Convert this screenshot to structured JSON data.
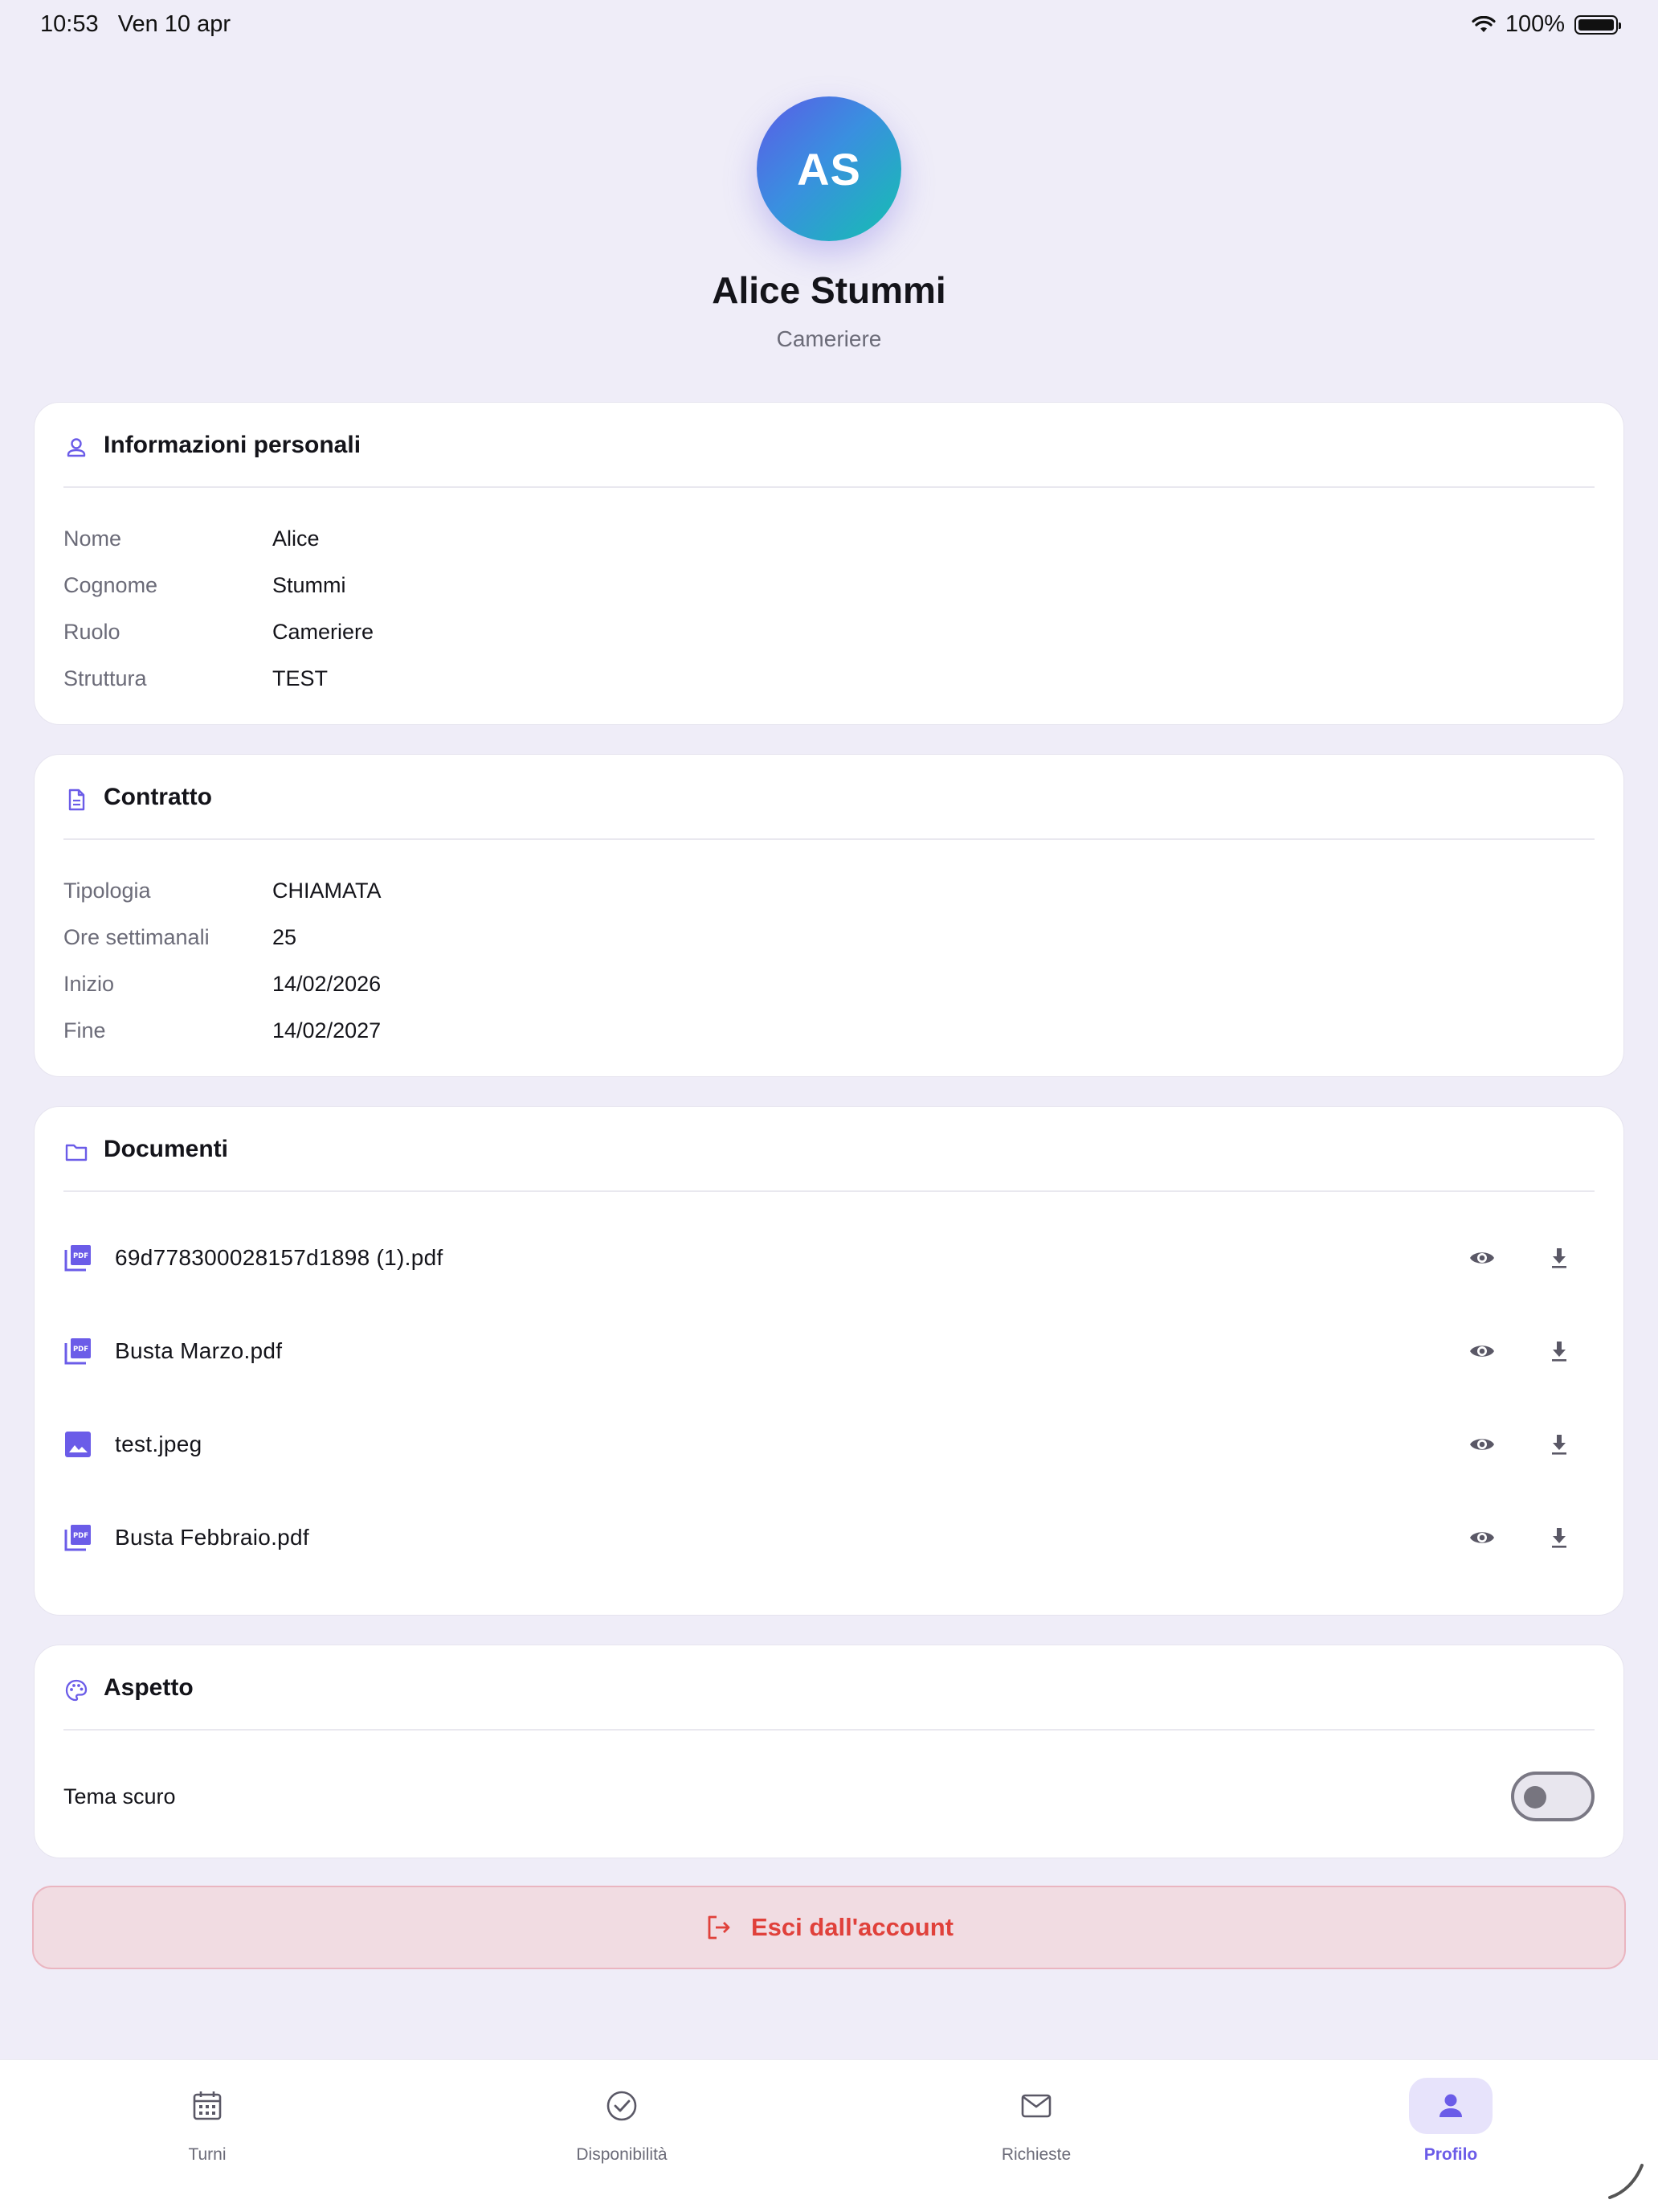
{
  "status_bar": {
    "time": "10:53",
    "date": "Ven 10 apr",
    "battery": "100%"
  },
  "profile": {
    "initials": "AS",
    "name": "Alice Stummi",
    "role": "Cameriere"
  },
  "personal": {
    "title": "Informazioni personali",
    "rows": [
      {
        "label": "Nome",
        "value": "Alice"
      },
      {
        "label": "Cognome",
        "value": "Stummi"
      },
      {
        "label": "Ruolo",
        "value": "Cameriere"
      },
      {
        "label": "Struttura",
        "value": "TEST"
      }
    ]
  },
  "contract": {
    "title": "Contratto",
    "rows": [
      {
        "label": "Tipologia",
        "value": "CHIAMATA"
      },
      {
        "label": "Ore settimanali",
        "value": "25"
      },
      {
        "label": "Inizio",
        "value": "14/02/2026"
      },
      {
        "label": "Fine",
        "value": "14/02/2027"
      }
    ]
  },
  "documents": {
    "title": "Documenti",
    "items": [
      {
        "name": "69d778300028157d1898 (1).pdf",
        "icon": "pdf-icon"
      },
      {
        "name": "Busta Marzo.pdf",
        "icon": "pdf-icon"
      },
      {
        "name": "test.jpeg",
        "icon": "image-icon"
      },
      {
        "name": "Busta Febbraio.pdf",
        "icon": "pdf-icon"
      }
    ]
  },
  "appearance": {
    "title": "Aspetto",
    "dark_theme_label": "Tema scuro",
    "dark_theme_on": false
  },
  "logout": {
    "label": "Esci dall'account"
  },
  "nav": {
    "items": [
      {
        "label": "Turni",
        "icon": "calendar-icon",
        "active": false
      },
      {
        "label": "Disponibilità",
        "icon": "check-circle-icon",
        "active": false
      },
      {
        "label": "Richieste",
        "icon": "mail-icon",
        "active": false
      },
      {
        "label": "Profilo",
        "icon": "person-icon",
        "active": true
      }
    ]
  },
  "colors": {
    "accent": "#6b5ce8",
    "danger": "#e0413b",
    "background": "#efedf8"
  }
}
